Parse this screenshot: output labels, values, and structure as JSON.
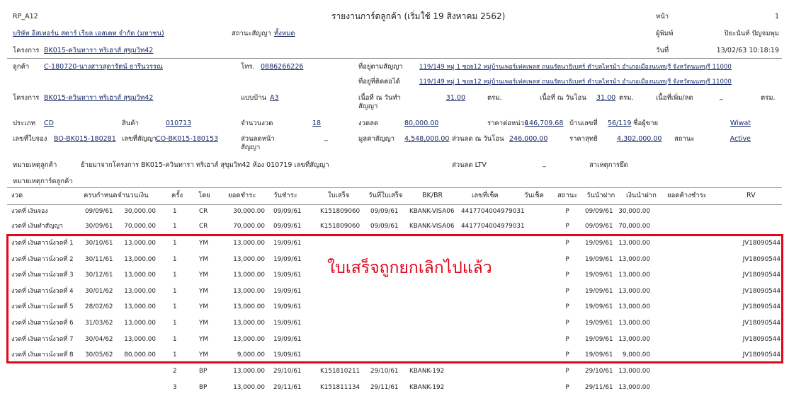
{
  "header": {
    "report_code": "RP_A12",
    "title": "รายงานการ์ดลูกค้า (เริ่มใช้ 19 สิงหาคม 2562)",
    "page_label": "หน้า",
    "page_value": "1",
    "company": "บริษัท อีสเทอร์น สตาร์ เรียล เอสเตท จำกัด (มหาชน)",
    "contract_status_label": "สถานะสัญญา",
    "contract_status_value": "ทั้งหมด",
    "printer_label": "ผู้พิมพ์",
    "printer_value": "ปิยะนันท์ ปัญจมพุม",
    "project_label": "โครงการ",
    "project_value": "BK015-ควินทารา ทริเฮาส์ สุขุมวิท42",
    "date_label": "วันที่",
    "date_value": "13/02/63 10:18:19"
  },
  "customer": {
    "customer_label": "ลูกค้า",
    "customer_value": "C-180720-นางสาวสุดารัตน์ ธารีนวรรณ",
    "phone_label": "โทร.",
    "phone_value": "0886266226",
    "addr_contract_label": "ที่อยู่ตามสัญญา",
    "addr_contract_value": "119/149 หมู่ 1 ซอย12 หมู่บ้านเพอร์เฟคเพลส ถนนรัตนาธิเบศร์ ตำบลไทรม้า อำเภอเมืองนนทบุรี จังหวัดนนทบุรี 11000",
    "addr_contact_label": "ที่อยู่ที่ติดต่อได้",
    "addr_contact_value": "119/149 หมู่ 1 ซอย12 หมู่บ้านเพอร์เฟคเพลส ถนนรัตนาธิเบศร์ ตำบลไทรม้า อำเภอเมืองนนทบุรี จังหวัดนนทบุรี 11000",
    "project_label": "โครงการ",
    "project_value": "BK015-ควินทารา ทริเฮาส์ สุขุมวิท42",
    "house_type_label": "แบบบ้าน",
    "house_type_value": "A3",
    "area_contract_label": "เนื้อที่ ณ วันทำสัญญา",
    "area_contract_value": "31.00",
    "unit_sqm": "ตรม.",
    "area_transfer_label": "เนื้อที่ ณ วันโอน",
    "area_transfer_value": "31.00",
    "unit_sqm2": "ตรม.",
    "area_diff_label": "เนื้อที่เพิ่ม/ลด",
    "area_diff_value": "_",
    "unit_sqm3": "ตรม.",
    "type_label": "ประเภท",
    "type_value": "CD",
    "product_label": "สินค้า",
    "product_value": "010713",
    "installments_label": "จำนวนงวด",
    "installments_value": "18",
    "down_label": "งวดลด",
    "down_value": "80,000.00",
    "unit_price_label": "ราคาต่อหน่วย",
    "unit_price_value": "146,709.68",
    "house_no_label": "บ้านเลขที่",
    "house_no_value": "56/119",
    "seller_label": "ชื่อผู้ขาย",
    "seller_value": "Wiwat",
    "booking_label": "เลขที่ใบจอง",
    "booking_value": "BO-BK015-180281",
    "contract_no_label": "เลขที่สัญญา",
    "contract_no_value": "CO-BK015-180153",
    "discount_front_label": "ส่วนลดหน้าสัญญา",
    "discount_front_value": "_",
    "contract_value_label": "มูลค่าสัญญา",
    "contract_value_value": "4,548,000.00",
    "discount_transfer_label": "ส่วนลด ณ วันโอน",
    "discount_transfer_value": "246,000.00",
    "net_price_label": "ราคาสุทธิ",
    "net_price_value": "4,302,000.00",
    "status_label": "สถานะ",
    "status_value": "Active",
    "note_label": "หมายเหตุลูกค้า",
    "note_value": "ย้ายมาจากโครงการ BK015-ควินทารา ทริเฮาส์ สุขุมวิท42 ห้อง 010719 เลขที่สัญญา",
    "ltv_label": "ส่วนลด LTV",
    "ltv_value": "_",
    "seize_label": "สาเหตุการยึด",
    "card_note_label": "หมายเหตุการ์ดลูกค้า"
  },
  "table": {
    "headers": [
      "งวด",
      "ครบกำหนด",
      "จำนวนเงิน",
      "ครั้ง",
      "โดย",
      "ยอดชำระ",
      "วันชำระ",
      "ใบเสร็จ",
      "วันที่ใบเสร็จ",
      "BK/BR",
      "เลขที่เช็ค",
      "วันเช็ค",
      "สถานะ",
      "วันนำฝาก",
      "เงินนำฝาก",
      "ยอดค้างชำระ",
      "RV"
    ],
    "rows": [
      [
        "งวดที่ เงินจอง",
        "09/09/61",
        "30,000.00",
        "1",
        "CR",
        "30,000.00",
        "09/09/61",
        "K151809060",
        "09/09/61",
        "KBANK-VISA06",
        "4417704004979031",
        "",
        "P",
        "09/09/61",
        "30,000.00",
        "",
        ""
      ],
      [
        "งวดที่ เงินทำสัญญา",
        "30/09/61",
        "70,000.00",
        "1",
        "CR",
        "70,000.00",
        "09/09/61",
        "K151809060",
        "09/09/61",
        "KBANK-VISA06",
        "4417704004979031",
        "",
        "P",
        "09/09/61",
        "70,000.00",
        "",
        ""
      ],
      [
        "งวดที่ เงินดาวน์งวดที่ 1",
        "30/10/61",
        "13,000.00",
        "1",
        "YM",
        "13,000.00",
        "19/09/61",
        "",
        "",
        "",
        "",
        "",
        "P",
        "19/09/61",
        "13,000.00",
        "",
        "JV18090544"
      ],
      [
        "งวดที่ เงินดาวน์งวดที่ 2",
        "30/11/61",
        "13,000.00",
        "1",
        "YM",
        "13,000.00",
        "19/09/61",
        "",
        "",
        "",
        "",
        "",
        "P",
        "19/09/61",
        "13,000.00",
        "",
        "JV18090544"
      ],
      [
        "งวดที่ เงินดาวน์งวดที่ 3",
        "30/12/61",
        "13,000.00",
        "1",
        "YM",
        "13,000.00",
        "19/09/61",
        "",
        "",
        "",
        "",
        "",
        "P",
        "19/09/61",
        "13,000.00",
        "",
        "JV18090544"
      ],
      [
        "งวดที่ เงินดาวน์งวดที่ 4",
        "30/01/62",
        "13,000.00",
        "1",
        "YM",
        "13,000.00",
        "19/09/61",
        "",
        "",
        "",
        "",
        "",
        "P",
        "19/09/61",
        "13,000.00",
        "",
        "JV18090544"
      ],
      [
        "งวดที่ เงินดาวน์งวดที่ 5",
        "28/02/62",
        "13,000.00",
        "1",
        "YM",
        "13,000.00",
        "19/09/61",
        "",
        "",
        "",
        "",
        "",
        "P",
        "19/09/61",
        "13,000.00",
        "",
        "JV18090544"
      ],
      [
        "งวดที่ เงินดาวน์งวดที่ 6",
        "31/03/62",
        "13,000.00",
        "1",
        "YM",
        "13,000.00",
        "19/09/61",
        "",
        "",
        "",
        "",
        "",
        "P",
        "19/09/61",
        "13,000.00",
        "",
        "JV18090544"
      ],
      [
        "งวดที่ เงินดาวน์งวดที่ 7",
        "30/04/62",
        "13,000.00",
        "1",
        "YM",
        "13,000.00",
        "19/09/61",
        "",
        "",
        "",
        "",
        "",
        "P",
        "19/09/61",
        "13,000.00",
        "",
        "JV18090544"
      ],
      [
        "งวดที่ เงินดาวน์งวดที่ 8",
        "30/05/62",
        "80,000.00",
        "1",
        "YM",
        "9,000.00",
        "19/09/61",
        "",
        "",
        "",
        "",
        "",
        "P",
        "19/09/61",
        "9,000.00",
        "",
        "JV18090544"
      ],
      [
        "",
        "",
        "",
        "2",
        "BP",
        "13,000.00",
        "29/10/61",
        "K151810211",
        "29/10/61",
        "KBANK-192",
        "",
        "",
        "P",
        "29/10/61",
        "13,000.00",
        "",
        ""
      ],
      [
        "",
        "",
        "",
        "3",
        "BP",
        "13,000.00",
        "29/11/61",
        "K151811134",
        "29/11/61",
        "KBANK-192",
        "",
        "",
        "P",
        "29/11/61",
        "13,000.00",
        "",
        ""
      ]
    ]
  },
  "annotation": {
    "text": "ใบเสร็จถูกยกเลิกไปแล้ว",
    "color": "#e1061b"
  }
}
